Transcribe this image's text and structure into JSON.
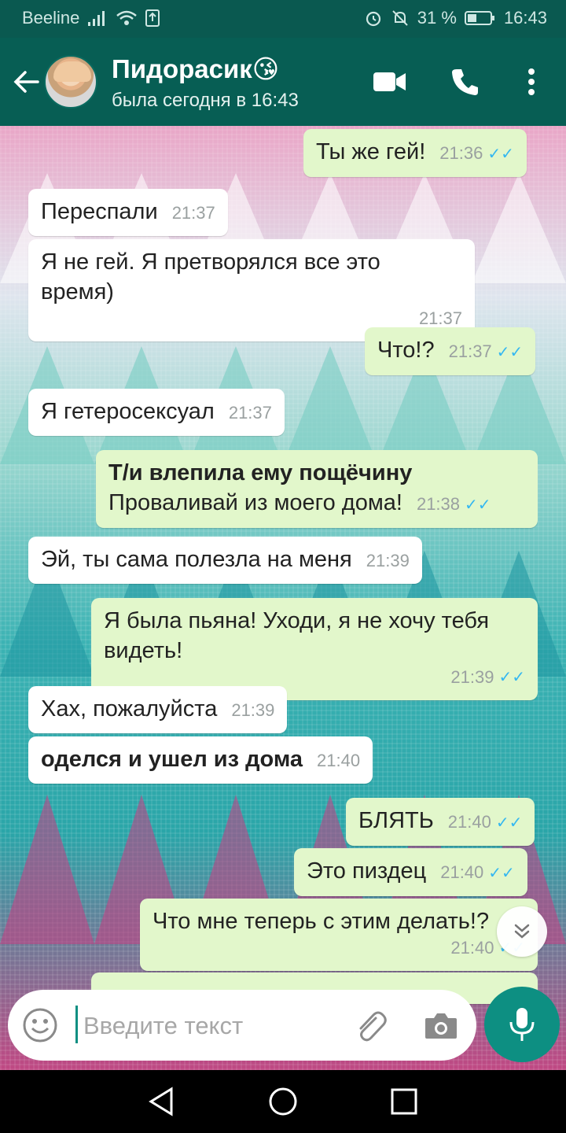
{
  "status_bar": {
    "carrier": "Beeline",
    "battery_percent": "31 %",
    "time": "16:43"
  },
  "header": {
    "contact_name": "Пидорасик😘",
    "last_seen": "была сегодня в 16:43"
  },
  "messages": [
    {
      "dir": "out",
      "text": "Ты же гей!",
      "time": "21:36"
    },
    {
      "dir": "in",
      "text": "Переспали",
      "time": "21:37"
    },
    {
      "dir": "in",
      "text": "Я не гей. Я претворялся все это время)",
      "time": "21:37"
    },
    {
      "dir": "out",
      "text": "Что!?",
      "time": "21:37"
    },
    {
      "dir": "in",
      "text": "Я гетеросексуал",
      "time": "21:37"
    },
    {
      "dir": "out",
      "bold_line": "Т/и влепила ему пощёчину",
      "text": "Проваливай из моего дома!",
      "time": "21:38"
    },
    {
      "dir": "in",
      "text": "Эй, ты сама полезла на меня",
      "time": "21:39"
    },
    {
      "dir": "out",
      "text": "Я была пьяна! Уходи, я не хочу тебя видеть!",
      "time": "21:39"
    },
    {
      "dir": "in",
      "text": "Хах, пожалуйста",
      "time": "21:39"
    },
    {
      "dir": "in",
      "text": "оделся и ушел из дома",
      "time": "21:40"
    },
    {
      "dir": "out",
      "text": "БЛЯТЬ",
      "time": "21:40"
    },
    {
      "dir": "out",
      "text": "Это пиздец",
      "time": "21:40"
    },
    {
      "dir": "out",
      "text": "Что мне теперь с этим делать!?",
      "time": "21:40"
    }
  ],
  "input": {
    "placeholder": "Введите текст"
  },
  "icons": {
    "back": "arrow-left-icon",
    "video": "video-camera-icon",
    "call": "phone-icon",
    "menu": "more-vertical-icon",
    "emoji": "emoji-icon",
    "attach": "paperclip-icon",
    "camera": "camera-icon",
    "mic": "microphone-icon",
    "scroll": "chevron-double-down-icon"
  },
  "colors": {
    "header": "#075e54",
    "outgoing_bubble": "#e2f7cb",
    "incoming_bubble": "#ffffff",
    "read_ticks": "#34b7f1",
    "accent": "#0d8f82"
  }
}
